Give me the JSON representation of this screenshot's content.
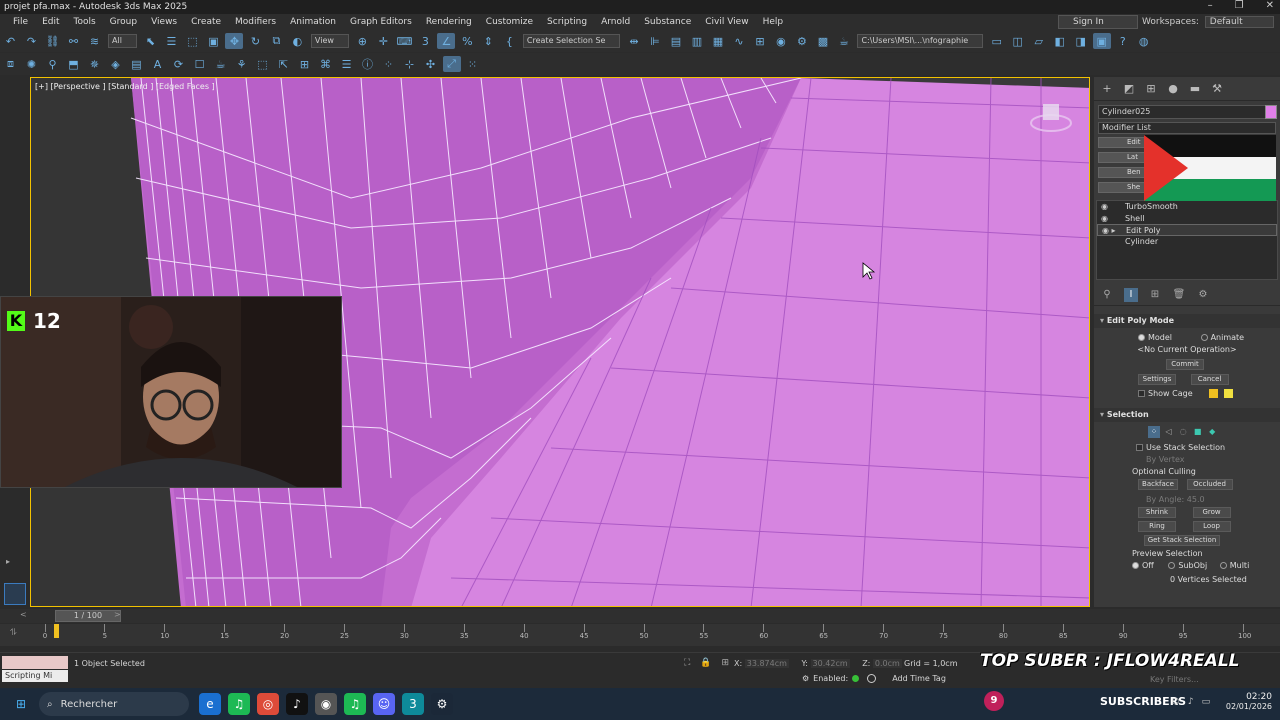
{
  "window": {
    "title": "projet pfa.max - Autodesk 3ds Max 2025",
    "minimize": "–",
    "maximize": "❐",
    "close": "✕"
  },
  "menu": [
    "File",
    "Edit",
    "Tools",
    "Group",
    "Views",
    "Create",
    "Modifiers",
    "Animation",
    "Graph Editors",
    "Rendering",
    "Customize",
    "Scripting",
    "Arnold",
    "Substance",
    "Civil View",
    "Help"
  ],
  "account": {
    "sign_in": "Sign In",
    "workspaces_label": "Workspaces:",
    "workspace": "Default"
  },
  "toolbar": {
    "filter": "All",
    "refcoord": "View",
    "selection_set": "Create Selection Se",
    "path": "C:\\Users\\MSI\\...\\nfographie"
  },
  "viewport": {
    "label": "[+] [Perspective ] [Standard ] [Edged Faces ]"
  },
  "command_panel": {
    "object_name": "Cylinder025",
    "object_color": "#e080e8",
    "modifier_list": "Modifier List",
    "mod_buttons": [
      "Edit",
      "Lat",
      "Ben",
      "She"
    ],
    "stack": [
      {
        "label": "TurboSmooth",
        "eye": true
      },
      {
        "label": "Shell",
        "eye": true
      },
      {
        "label": "Edit Poly",
        "eye": true,
        "selected": true
      },
      {
        "label": "Cylinder",
        "eye": false
      }
    ],
    "edit_poly_mode": {
      "title": "Edit Poly Mode",
      "model": "Model",
      "animate": "Animate",
      "operation": "<No Current Operation>",
      "commit": "Commit",
      "settings": "Settings",
      "cancel": "Cancel",
      "show_cage": "Show Cage",
      "cage_color1": "#f0c020",
      "cage_color2": "#f0e040"
    },
    "selection": {
      "title": "Selection",
      "use_stack": "Use Stack Selection",
      "by_vertex": "By Vertex",
      "optional_culling": "Optional Culling",
      "backface": "Backface",
      "occluded": "Occluded",
      "by_angle": "By Angle:",
      "angle": "45.0",
      "shrink": "Shrink",
      "grow": "Grow",
      "ring": "Ring",
      "loop": "Loop",
      "get_stack": "Get Stack Selection",
      "preview": "Preview Selection",
      "off": "Off",
      "subobj": "SubObj",
      "multi": "Multi",
      "status": "0 Vertices Selected"
    }
  },
  "timeline": {
    "frames": "1 / 100",
    "ticks": [
      "0",
      "5",
      "10",
      "15",
      "20",
      "25",
      "30",
      "35",
      "40",
      "45",
      "50",
      "55",
      "60",
      "65",
      "70",
      "75",
      "80",
      "85",
      "90",
      "95",
      "100"
    ]
  },
  "status": {
    "selected": "1 Object Selected",
    "script_box": "Scripting Mi",
    "x_label": "X:",
    "x": "33.874cm",
    "y_label": "Y:",
    "y": "30.42cm",
    "z_label": "Z:",
    "z": "0.0cm",
    "grid": "Grid = 1,0cm",
    "enabled": "Enabled:",
    "add_time_tag": "Add Time Tag",
    "key_filters": "Key Filters..."
  },
  "overlay": {
    "kick_count": "12",
    "banner": "TOP SUBER : JFLOW4REALL",
    "subs": "SUBSCRIBERS",
    "subs_count": "9"
  },
  "taskbar": {
    "search": "Rechercher",
    "time": "02:20",
    "date": "02/01/2026"
  }
}
